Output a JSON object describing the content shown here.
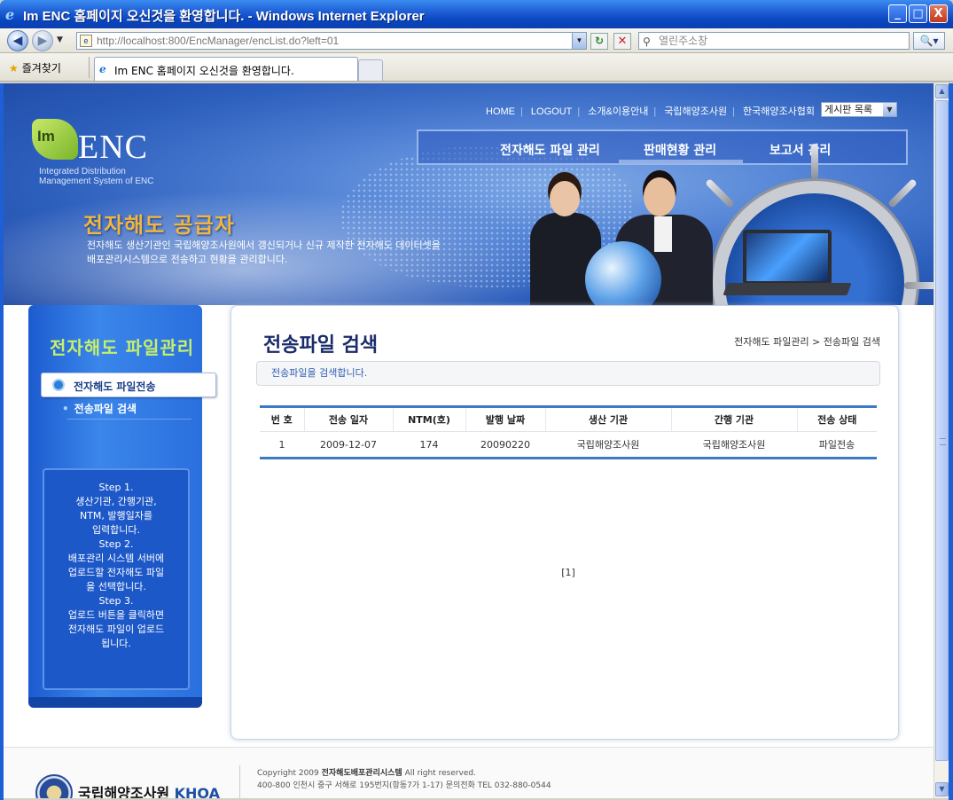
{
  "window": {
    "title": "Im ENC 홈페이지 오신것을 환영합니다. - Windows Internet Explorer",
    "min_label": "_",
    "max_label": "□",
    "close_label": "X"
  },
  "addressbar": {
    "back": "◀",
    "forward": "▶",
    "url": "http://localhost:800/EncManager/encList.do?left=01",
    "search_placeholder": "열린주소창",
    "refresh": "↻",
    "stop": "✕",
    "search_go": "🔍▾"
  },
  "favorites": {
    "label": "즐겨찾기",
    "tab_title": "Im ENC 홈페이지 오신것을 환영합니다."
  },
  "site": {
    "logo_mark": "Im",
    "logo_text": "ENC",
    "logo_sub_line1": "Integrated Distribution",
    "logo_sub_line2": "Management System of ENC",
    "topnav": [
      "HOME",
      "LOGOUT",
      "소개&이용안내",
      "국립해양조사원",
      "한국해양조사협회"
    ],
    "board_select": "게시판 목록",
    "mainnav": [
      "전자해도 파일 관리",
      "판매현황 관리",
      "보고서 관리"
    ],
    "supplier_title": "전자해도 공급자",
    "supplier_desc_line1": "전자해도 생산기관인 국립해양조사원에서 갱신되거나 신규 제작한 전자해도 데이터셋을",
    "supplier_desc_line2": "배포관리시스템으로 전송하고 현황을 관리합니다."
  },
  "sidebar": {
    "title": "전자해도 파일관리",
    "selected": "전자해도 파일전송",
    "sub_item": "전송파일 검색",
    "steps": [
      "Step 1.",
      "생산기관, 간행기관,",
      "NTM, 발행일자를",
      "입력합니다.",
      "Step 2.",
      "배포관리 시스템 서버에",
      "업로드할 전자해도 파일",
      "을 선택합니다.",
      "Step 3.",
      "업로드 버튼을 클릭하면",
      "전자해도 파일이 업로드",
      "됩니다."
    ]
  },
  "content": {
    "title": "전송파일 검색",
    "breadcrumb": "전자해도 파일관리 > 전송파일 검색",
    "description": "전송파일을 검색합니다.",
    "table": {
      "headers": [
        "번 호",
        "전송 일자",
        "NTM(호)",
        "발행 날짜",
        "생산 기관",
        "간행 기관",
        "전송 상태"
      ],
      "rows": [
        [
          "1",
          "2009-12-07",
          "174",
          "20090220",
          "국립해양조사원",
          "국립해양조사원",
          "파일전송"
        ]
      ]
    },
    "pager": "[1]"
  },
  "footer": {
    "org_name": "국립해양조사원",
    "org_abbr": "KHOA",
    "copyright_prefix": "Copyright  2009 ",
    "copyright_name": "전자해도배포관리시스템",
    "copyright_suffix": " All right reserved.",
    "address": "400-800 인천시 중구 서해로 195번지(항동7가 1-17)  문의전화 TEL 032-880-0544"
  }
}
